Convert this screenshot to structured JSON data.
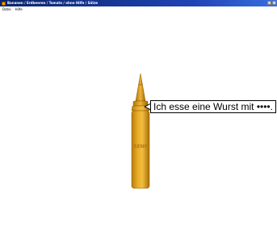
{
  "window": {
    "title": "Bananen / Erdbeeren / Tomate / ohne Hilfe / Sätze"
  },
  "menu": {
    "items": [
      "Datei",
      "Hilfe"
    ]
  },
  "stage": {
    "bottle_label": "SENF",
    "sentence": "Ich esse eine Wurst mit ••••.",
    "bottle_color": "#e3a51c"
  },
  "icons": {
    "app": "app-icon",
    "minimize": "minimize-icon",
    "close": "close-icon"
  }
}
